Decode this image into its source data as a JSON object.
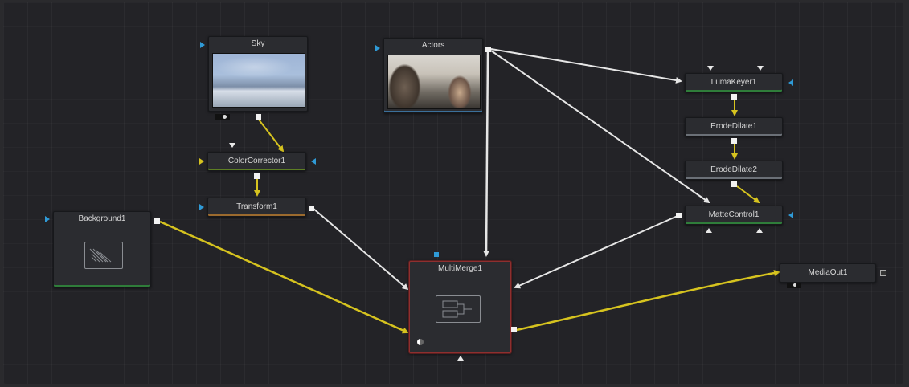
{
  "nodes": {
    "sky": {
      "label": "Sky"
    },
    "actors": {
      "label": "Actors"
    },
    "color_corrector": {
      "label": "ColorCorrector1"
    },
    "transform": {
      "label": "Transform1"
    },
    "background": {
      "label": "Background1"
    },
    "multimerge": {
      "label": "MultiMerge1"
    },
    "lumakeyer": {
      "label": "LumaKeyer1"
    },
    "erodedilate1": {
      "label": "ErodeDilate1"
    },
    "erodedilate2": {
      "label": "ErodeDilate2"
    },
    "mattecontrol": {
      "label": "MatteControl1"
    },
    "mediaout": {
      "label": "MediaOut1"
    }
  },
  "colors": {
    "canvas": "#232327",
    "input_port": "#2f9ad6",
    "yellow_wire": "#d6c31f",
    "white_wire": "#e6e6e6",
    "merge_border": "#8e2f2f"
  },
  "icons": {
    "background": "gradient-rect-icon",
    "multimerge": "merge-layers-icon",
    "view_toggle": "half-circle-icon"
  }
}
